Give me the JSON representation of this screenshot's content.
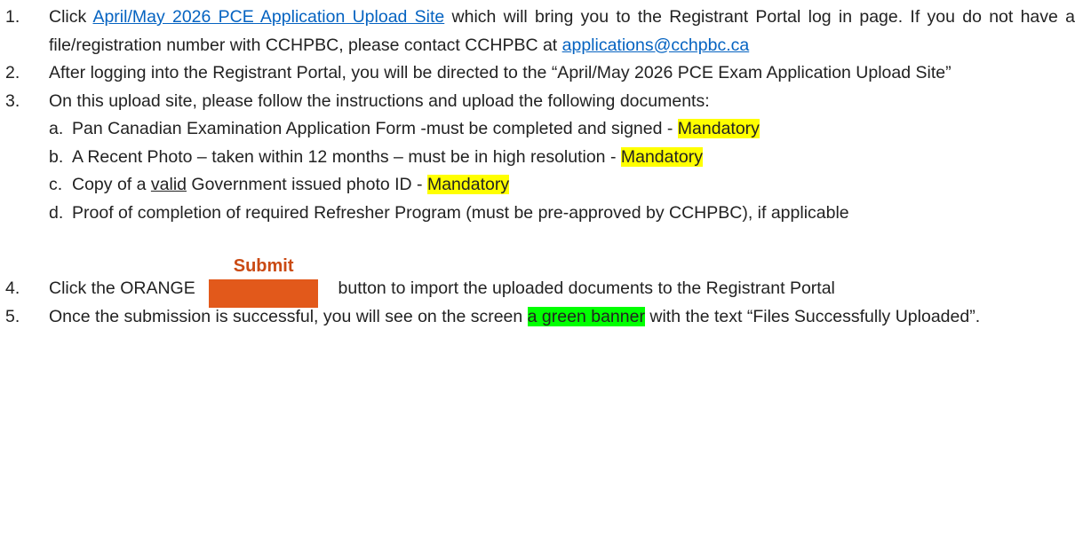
{
  "items": {
    "step1": {
      "num": "1.",
      "pre": "Click ",
      "link": "April/May 2026 PCE Application Upload Site",
      "post": " which will bring you to the Registrant Portal log in page. If you do not have a file/registration number with CCHPBC, please contact CCHPBC at ",
      "email": "applications@cchpbc.ca"
    },
    "step2": {
      "num": "2.",
      "text": "After logging into the Registrant Portal, you will be directed to the “April/May 2026 PCE Exam Application Upload Site”"
    },
    "step3": {
      "num": "3.",
      "text": "On this upload site, please follow the instructions and upload the following documents:",
      "sub_a": {
        "letter": "a.",
        "text": "Pan Canadian Examination Application Form -must be completed and signed - ",
        "badge": "Mandatory"
      },
      "sub_b": {
        "letter": "b.",
        "text": "A Recent Photo – taken within 12 months – must be in high resolution - ",
        "badge": "Mandatory"
      },
      "sub_c": {
        "letter": "c.",
        "pre": "Copy of a ",
        "underlined": "valid",
        "post": " Government issued photo ID - ",
        "badge": "Mandatory"
      },
      "sub_d": {
        "letter": "d.",
        "text": "Proof of completion of required Refresher Program (must be pre-approved by CCHPBC), if applicable"
      }
    },
    "step4": {
      "num": "4.",
      "pre": "Click the ORANGE ",
      "button_label": "Submit",
      "post": " button to import the uploaded documents to the Registrant Portal"
    },
    "step5": {
      "num": "5.",
      "pre": "Once the submission is successful, you will see on the screen ",
      "highlight": "a green banner",
      "post": " with the text “Files Successfully Uploaded”."
    }
  },
  "colors": {
    "link": "#0563c1",
    "highlight_yellow": "#ffff00",
    "highlight_green": "#00ff00",
    "submit_orange": "#e2591b",
    "submit_label": "#ca4a13"
  }
}
